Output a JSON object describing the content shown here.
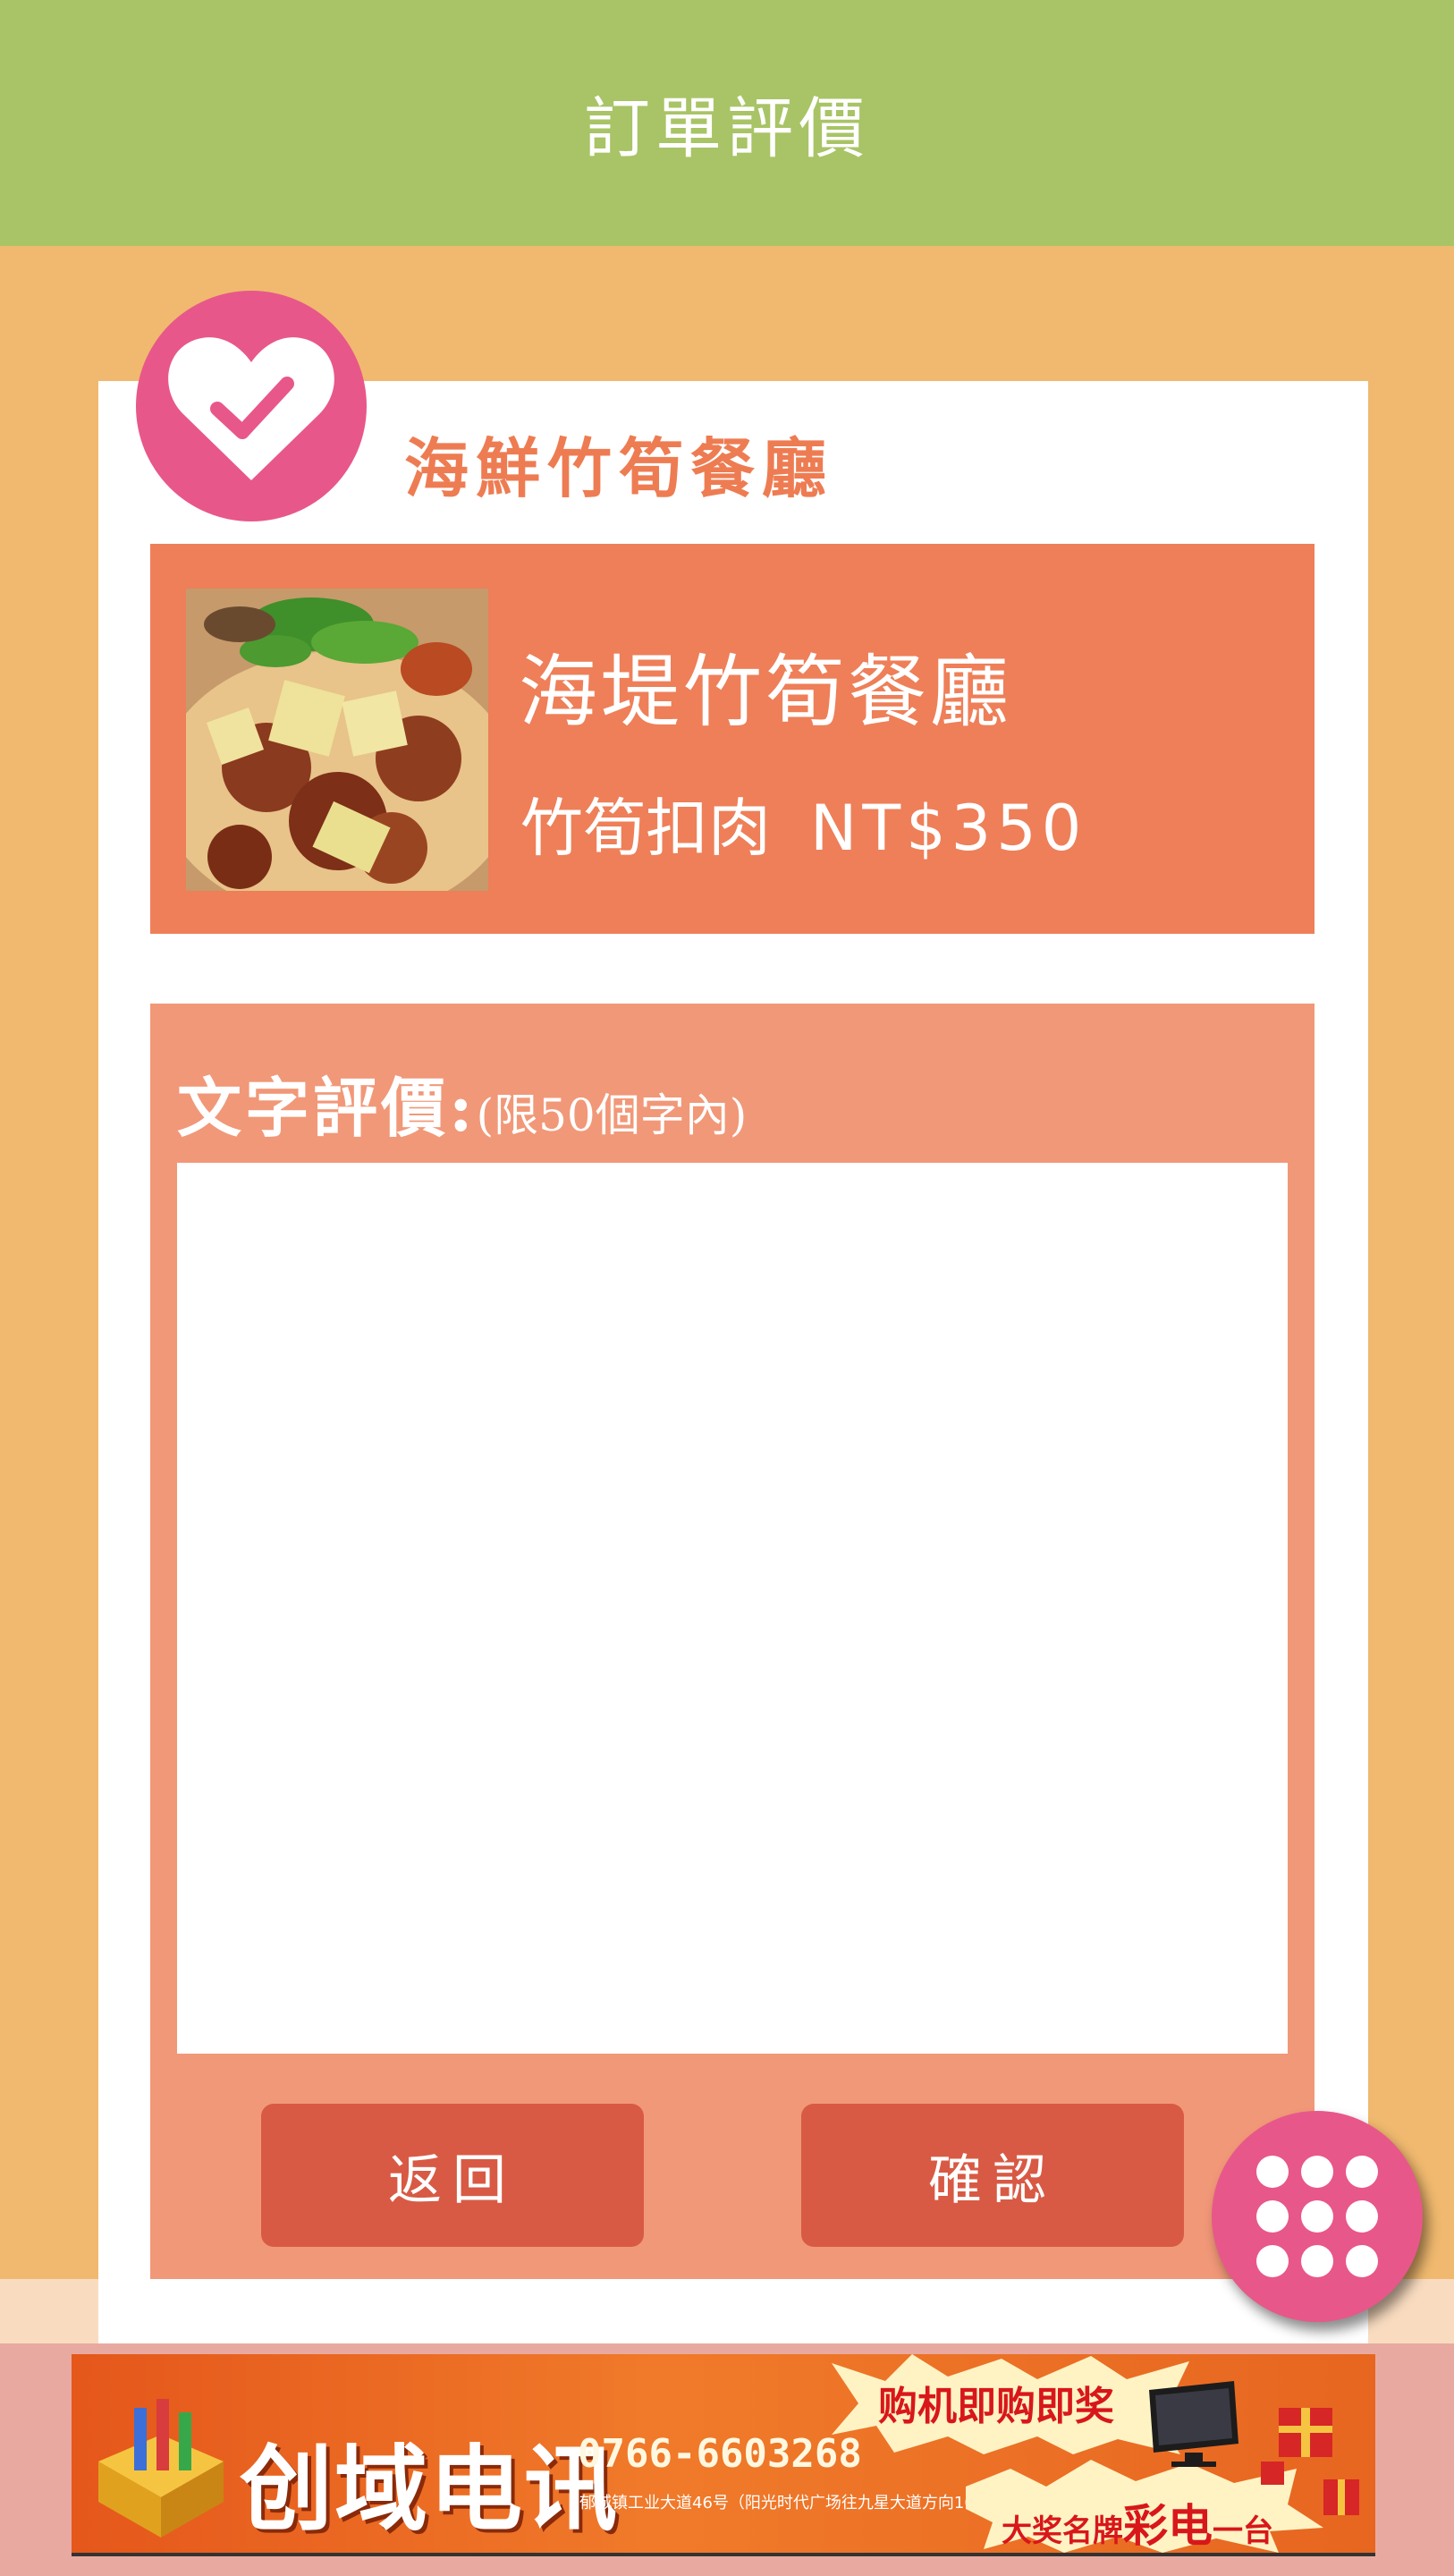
{
  "header": {
    "title": "訂單評價"
  },
  "restaurant": {
    "name": "海鮮竹筍餐廳"
  },
  "order": {
    "store_name": "海堤竹筍餐廳",
    "item_name": "竹筍扣肉",
    "price": "NT$350"
  },
  "review": {
    "label": "文字評價:",
    "hint": "(限50個字內)",
    "text_value": "",
    "placeholder": ""
  },
  "buttons": {
    "back": "返回",
    "confirm": "確認"
  },
  "ad": {
    "brand": "创域电讯",
    "phone": "0766-6603268",
    "address": "郁城镇工业大道46号（阳光时代广场往九星大道方向100米）",
    "promo": "购机即购即奖",
    "prize_prefix": "大奖名牌",
    "prize_em": "彩电",
    "prize_suffix": "一台"
  },
  "colors": {
    "header_bg": "#a8c466",
    "page_bg": "#f0b96f",
    "accent_pink": "#e8578a",
    "product_bg": "#ee7f58",
    "review_bg": "#f19878",
    "button_bg": "#d85a44",
    "restaurant_text": "#ee7c52"
  },
  "icons": {
    "badge": "heart-check-icon",
    "fab": "grid-menu-icon",
    "food": "food-photo"
  }
}
